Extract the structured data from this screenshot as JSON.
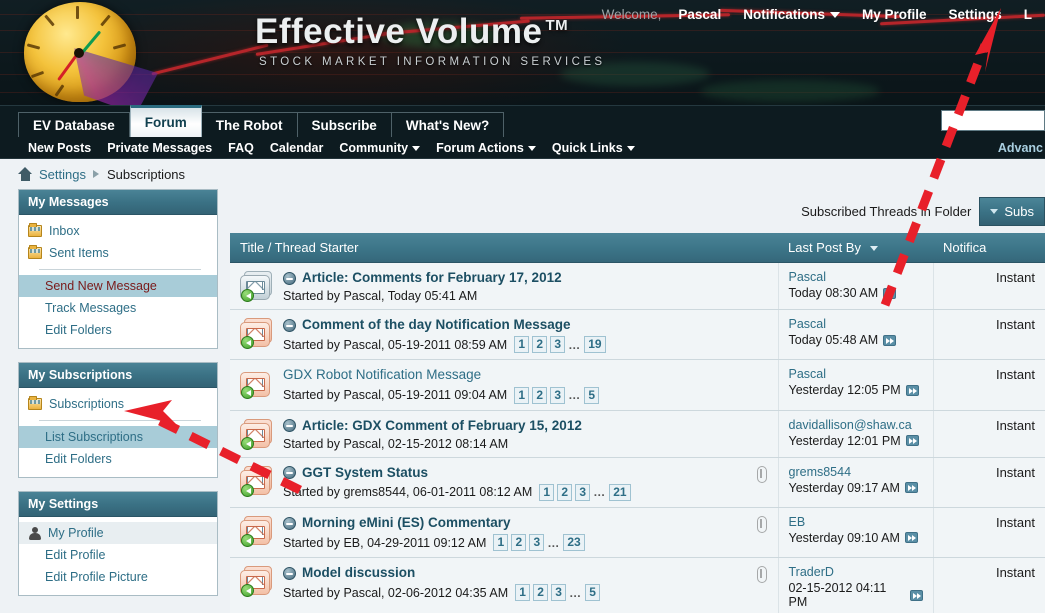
{
  "header": {
    "brand_title": "Effective Volume",
    "brand_tm": "TM",
    "brand_sub": "STOCK MARKET INFORMATION SERVICES",
    "welcome_label": "Welcome,",
    "user_name": "Pascal",
    "nav": [
      {
        "label": "Notifications",
        "caret": true
      },
      {
        "label": "My Profile",
        "caret": false
      },
      {
        "label": "Settings",
        "caret": false
      },
      {
        "label": "L",
        "caret": false
      }
    ]
  },
  "tabs": [
    {
      "label": "EV Database",
      "active": false
    },
    {
      "label": "Forum",
      "active": true
    },
    {
      "label": "The Robot",
      "active": false
    },
    {
      "label": "Subscribe",
      "active": false
    },
    {
      "label": "What's New?",
      "active": false
    }
  ],
  "search": {
    "value": "",
    "placeholder": ""
  },
  "subnav": {
    "items": [
      {
        "label": "New Posts",
        "caret": false
      },
      {
        "label": "Private Messages",
        "caret": false
      },
      {
        "label": "FAQ",
        "caret": false
      },
      {
        "label": "Calendar",
        "caret": false
      },
      {
        "label": "Community",
        "caret": true
      },
      {
        "label": "Forum Actions",
        "caret": true
      },
      {
        "label": "Quick Links",
        "caret": true
      }
    ],
    "advanced": "Advanc"
  },
  "breadcrumb": {
    "home_icon": "home-icon",
    "items": [
      "Settings",
      "Subscriptions"
    ]
  },
  "sidebar": {
    "panels": [
      {
        "title": "My Messages",
        "items": [
          {
            "label": "Inbox",
            "icon": "folder-icon",
            "state": "normal"
          },
          {
            "label": "Sent Items",
            "icon": "folder-icon",
            "state": "normal"
          },
          {
            "divider": true
          },
          {
            "label": "Send New Message",
            "icon": null,
            "state": "selected-red"
          },
          {
            "label": "Track Messages",
            "icon": null,
            "state": "normal-indent"
          },
          {
            "label": "Edit Folders",
            "icon": null,
            "state": "normal-indent"
          }
        ]
      },
      {
        "title": "My Subscriptions",
        "items": [
          {
            "label": "Subscriptions",
            "icon": "folder-icon",
            "state": "normal"
          },
          {
            "divider": true
          },
          {
            "label": "List Subscriptions",
            "icon": null,
            "state": "selected"
          },
          {
            "label": "Edit Folders",
            "icon": null,
            "state": "normal-indent"
          }
        ]
      },
      {
        "title": "My Settings",
        "items": [
          {
            "label": "My Profile",
            "icon": "person-icon",
            "state": "highlight"
          },
          {
            "label": "Edit Profile",
            "icon": null,
            "state": "normal-indent"
          },
          {
            "label": "Edit Profile Picture",
            "icon": null,
            "state": "normal-indent"
          }
        ]
      }
    ]
  },
  "main": {
    "folder_label": "Subscribed Threads in Folder",
    "folder_button": "Subs",
    "columns": {
      "title": "Title / Thread Starter",
      "last_post": "Last Post By",
      "notification": "Notifica"
    },
    "rows": [
      {
        "icon": "envelope-stack-blue-icon",
        "title": "Article: Comments for February 17, 2012",
        "title_bold": true,
        "has_prefix_icon": true,
        "starter": "Started by Pascal, Today 05:41 AM",
        "pages": [],
        "attachment": false,
        "last_post_user": "Pascal",
        "last_post_time": "Today 08:30 AM",
        "notification": "Instant"
      },
      {
        "icon": "envelope-stack-red-icon",
        "title": "Comment of the day Notification Message",
        "title_bold": true,
        "has_prefix_icon": true,
        "starter": "Started by Pascal, 05-19-2011 08:59 AM",
        "pages": [
          "1",
          "2",
          "3",
          "...",
          "19"
        ],
        "attachment": false,
        "last_post_user": "Pascal",
        "last_post_time": "Today 05:48 AM",
        "notification": "Instant"
      },
      {
        "icon": "envelope-single-red-icon",
        "title": "GDX Robot Notification Message",
        "title_bold": false,
        "has_prefix_icon": false,
        "starter": "Started by Pascal, 05-19-2011 09:04 AM",
        "pages": [
          "1",
          "2",
          "3",
          "...",
          "5"
        ],
        "attachment": false,
        "last_post_user": "Pascal",
        "last_post_time": "Yesterday 12:05 PM",
        "notification": "Instant"
      },
      {
        "icon": "envelope-stack-red-icon",
        "title": "Article: GDX Comment of February 15, 2012",
        "title_bold": true,
        "has_prefix_icon": true,
        "starter": "Started by Pascal, 02-15-2012 08:14 AM",
        "pages": [],
        "attachment": false,
        "last_post_user": "davidallison@shaw.ca",
        "last_post_time": "Yesterday 12:01 PM",
        "notification": "Instant"
      },
      {
        "icon": "envelope-stack-red-icon",
        "title": "GGT System Status",
        "title_bold": true,
        "has_prefix_icon": true,
        "starter": "Started by grems8544, 06-01-2011 08:12 AM",
        "pages": [
          "1",
          "2",
          "3",
          "...",
          "21"
        ],
        "attachment": true,
        "last_post_user": "grems8544",
        "last_post_time": "Yesterday 09:17 AM",
        "notification": "Instant"
      },
      {
        "icon": "envelope-stack-red-icon",
        "title": "Morning eMini (ES) Commentary",
        "title_bold": true,
        "has_prefix_icon": true,
        "starter": "Started by EB, 04-29-2011 09:12 AM",
        "pages": [
          "1",
          "2",
          "3",
          "...",
          "23"
        ],
        "attachment": true,
        "last_post_user": "EB",
        "last_post_time": "Yesterday 09:10 AM",
        "notification": "Instant"
      },
      {
        "icon": "envelope-stack-red-icon",
        "title": "Model discussion",
        "title_bold": true,
        "has_prefix_icon": true,
        "starter": "Started by Pascal, 02-06-2012 04:35 AM",
        "pages": [
          "1",
          "2",
          "3",
          "...",
          "5"
        ],
        "attachment": true,
        "last_post_user": "TraderD",
        "last_post_time": "02-15-2012 04:11 PM",
        "notification": "Instant"
      }
    ]
  },
  "annotations": {
    "arrow_color": "#e8202a",
    "arrow_1_target": "Settings",
    "arrow_2_target": "Subscriptions"
  }
}
